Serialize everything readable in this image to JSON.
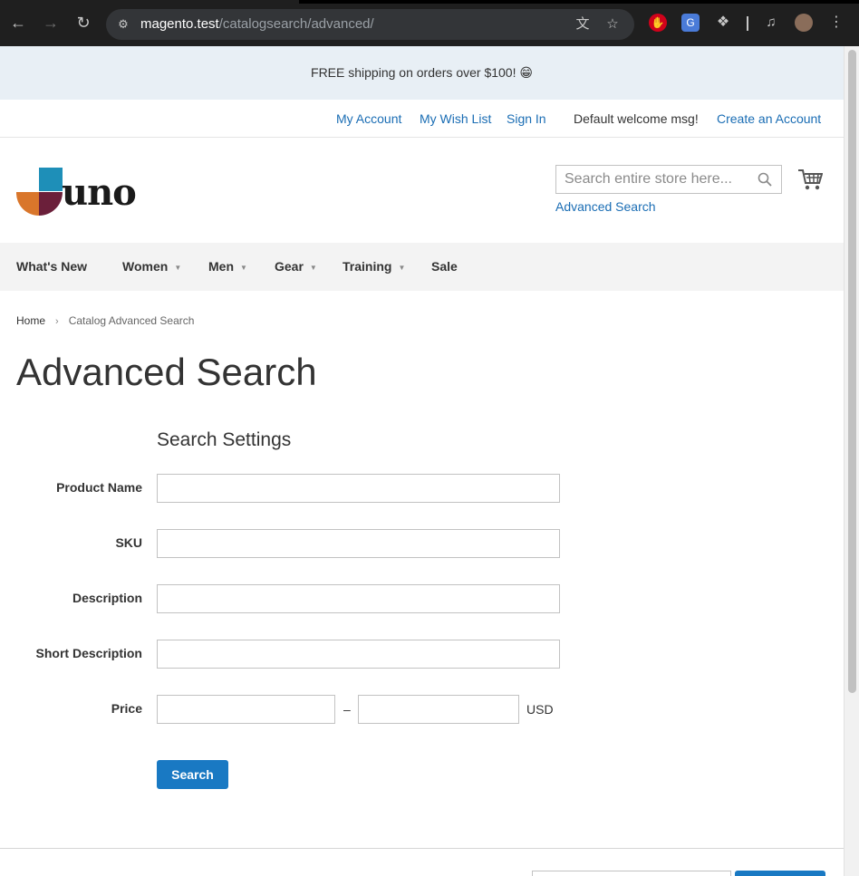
{
  "browser": {
    "url_host": "magento.test",
    "url_path": "/catalogsearch/advanced/"
  },
  "promo": {
    "text": "FREE shipping on orders over $100! 😁"
  },
  "header_links": {
    "my_account": "My Account",
    "my_wish_list": "My Wish List",
    "sign_in": "Sign In",
    "welcome": "Default welcome msg!",
    "create_account": "Create an Account"
  },
  "logo": {
    "text": "uno"
  },
  "search": {
    "placeholder": "Search entire store here...",
    "advanced_link": "Advanced Search"
  },
  "nav": {
    "items": [
      {
        "label": "What's New"
      },
      {
        "label": "Women"
      },
      {
        "label": "Men"
      },
      {
        "label": "Gear"
      },
      {
        "label": "Training"
      },
      {
        "label": "Sale"
      }
    ]
  },
  "breadcrumb": {
    "home": "Home",
    "separator": "›",
    "current": "Catalog Advanced Search"
  },
  "page_title": "Advanced Search",
  "form": {
    "legend": "Search Settings",
    "fields": {
      "product_name": {
        "label": "Product Name",
        "value": ""
      },
      "sku": {
        "label": "SKU",
        "value": ""
      },
      "description": {
        "label": "Description",
        "value": ""
      },
      "short_description": {
        "label": "Short Description",
        "value": ""
      },
      "price": {
        "label": "Price",
        "from": "",
        "to": "",
        "separator": "–",
        "currency": "USD"
      }
    },
    "submit_label": "Search"
  },
  "colors": {
    "link": "#1a6db4",
    "primary_button": "#1979c3",
    "promo_bg": "#e8eff5",
    "nav_bg": "#f3f3f3",
    "logo_blue": "#1e8fb8",
    "logo_orange": "#d9762b",
    "logo_maroon": "#6b1f3a"
  }
}
